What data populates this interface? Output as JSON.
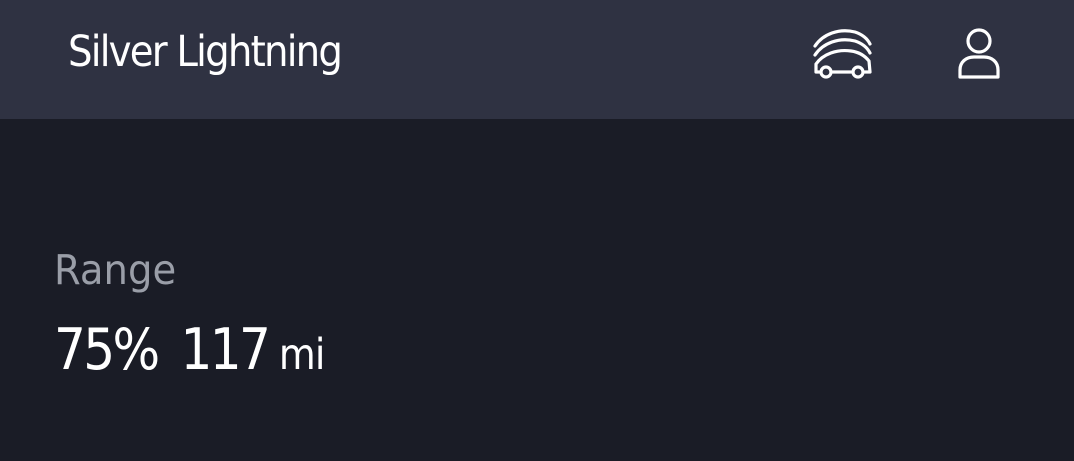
{
  "header": {
    "vehicle_name": "Silver Lightning",
    "icons": {
      "vehicles": "vehicles-icon",
      "account": "account-icon"
    }
  },
  "range": {
    "label": "Range",
    "percent": "75%",
    "distance": "117",
    "unit": "mi"
  },
  "colors": {
    "background": "#1a1c26",
    "header": "#2f3242",
    "label": "#9a9ea8",
    "text": "#ffffff"
  }
}
